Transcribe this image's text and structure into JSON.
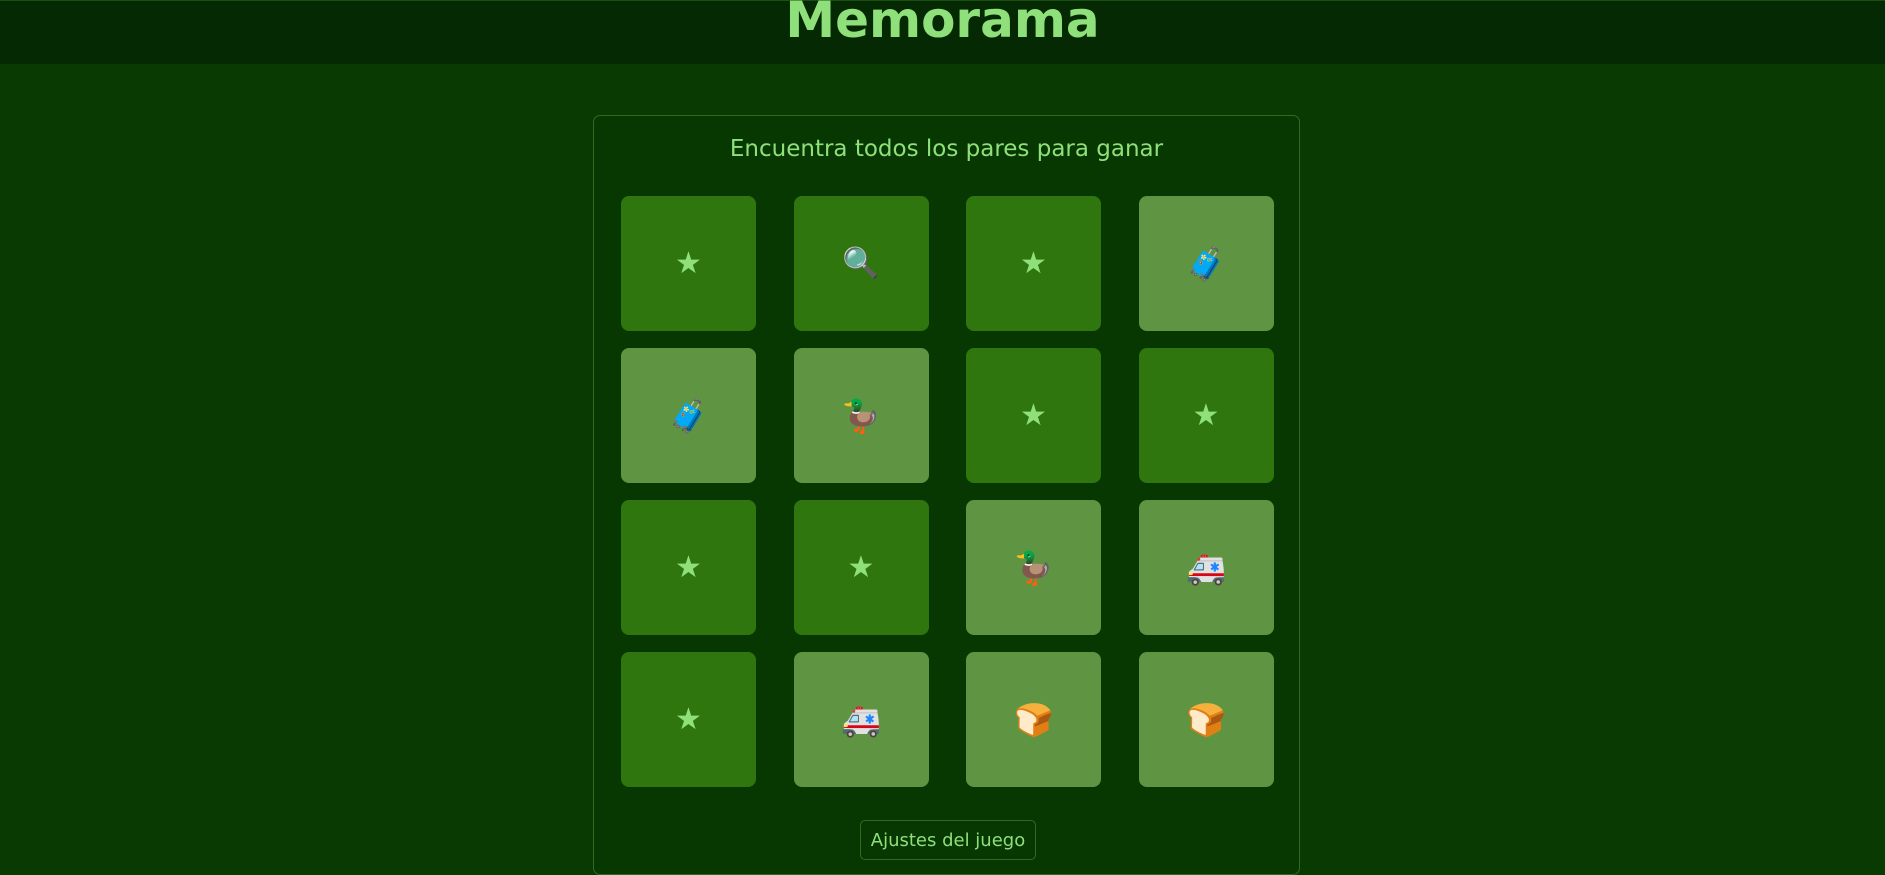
{
  "header": {
    "title": "Memorama"
  },
  "game": {
    "instructions": "Encuentra todos los pares para ganar",
    "settings_label": "Ajustes del juego",
    "colors": {
      "background": "#083a02",
      "header": "#052902",
      "hidden_card": "#30760e",
      "revealed_card": "#5f9443",
      "accent_text": "#8fe07a"
    },
    "cards": [
      {
        "state": "hidden",
        "symbol": "★",
        "icon": "star-icon"
      },
      {
        "state": "hidden",
        "symbol": "🔍",
        "icon": "magnifying-glass-icon"
      },
      {
        "state": "hidden",
        "symbol": "★",
        "icon": "star-icon"
      },
      {
        "state": "revealed",
        "symbol": "🧳",
        "icon": "luggage-icon"
      },
      {
        "state": "revealed",
        "symbol": "🧳",
        "icon": "luggage-icon"
      },
      {
        "state": "revealed",
        "symbol": "🦆",
        "icon": "duck-icon"
      },
      {
        "state": "hidden",
        "symbol": "★",
        "icon": "star-icon"
      },
      {
        "state": "hidden",
        "symbol": "★",
        "icon": "star-icon"
      },
      {
        "state": "hidden",
        "symbol": "★",
        "icon": "star-icon"
      },
      {
        "state": "hidden",
        "symbol": "★",
        "icon": "star-icon"
      },
      {
        "state": "revealed",
        "symbol": "🦆",
        "icon": "duck-icon"
      },
      {
        "state": "revealed",
        "symbol": "🚑",
        "icon": "ambulance-icon"
      },
      {
        "state": "hidden",
        "symbol": "★",
        "icon": "star-icon"
      },
      {
        "state": "revealed",
        "symbol": "🚑",
        "icon": "ambulance-icon"
      },
      {
        "state": "revealed",
        "symbol": "🍞",
        "icon": "bread-icon"
      },
      {
        "state": "revealed",
        "symbol": "🍞",
        "icon": "bread-icon"
      }
    ]
  }
}
